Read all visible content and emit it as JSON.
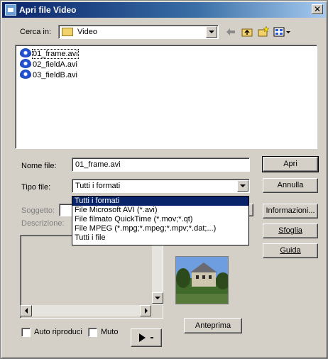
{
  "window": {
    "title": "Apri file Video"
  },
  "look_in": {
    "label": "Cerca in:",
    "value": "Video"
  },
  "files": [
    {
      "name": "01_frame.avi",
      "selected": true
    },
    {
      "name": "02_fieldA.avi",
      "selected": false
    },
    {
      "name": "03_fieldB.avi",
      "selected": false
    }
  ],
  "filename": {
    "label": "Nome file:",
    "value": "01_frame.avi"
  },
  "filetype": {
    "label": "Tipo file:",
    "value": "Tutti i formati",
    "options": [
      "Tutti i formati",
      "File Microsoft AVI (*.avi)",
      "File filmato QuickTime (*.mov;*.qt)",
      "File MPEG (*.mpg;*.mpeg;*.mpv;*.dat;...)",
      "Tutti i file"
    ]
  },
  "info": {
    "subject_label": "Soggetto:",
    "description_label": "Descrizione:"
  },
  "buttons": {
    "open": "Apri",
    "cancel": "Annulla",
    "information": "Informazioni...",
    "browse": "Sfoglia",
    "help": "Guida",
    "preview": "Anteprima"
  },
  "options": {
    "autoplay": "Auto riproduci",
    "mute": "Muto"
  },
  "icons": {
    "back": "back-arrow-icon",
    "up": "up-folder-icon",
    "new_folder": "new-folder-icon",
    "views": "view-menu-icon",
    "play": "play-icon"
  },
  "colors": {
    "titlebar": "#0a246a",
    "selection": "#0a246a",
    "face": "#d4d0c8"
  }
}
